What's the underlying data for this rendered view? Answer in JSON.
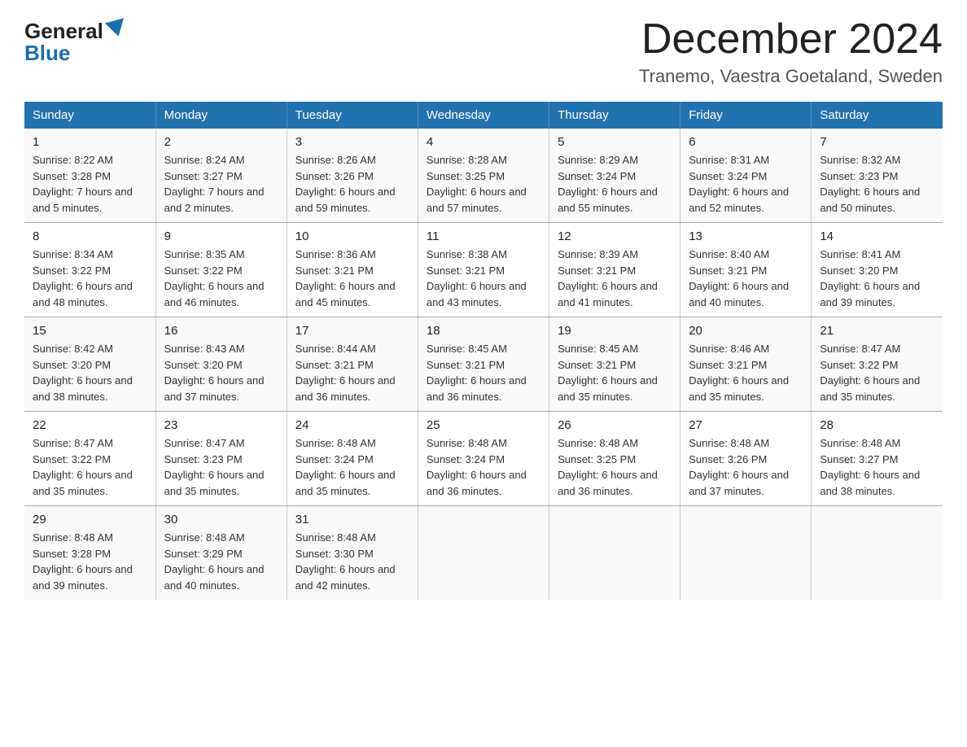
{
  "header": {
    "logo_general": "General",
    "logo_blue": "Blue",
    "main_title": "December 2024",
    "subtitle": "Tranemo, Vaestra Goetaland, Sweden"
  },
  "days_of_week": [
    "Sunday",
    "Monday",
    "Tuesday",
    "Wednesday",
    "Thursday",
    "Friday",
    "Saturday"
  ],
  "weeks": [
    [
      {
        "day": "1",
        "sunrise": "8:22 AM",
        "sunset": "3:28 PM",
        "daylight": "7 hours and 5 minutes."
      },
      {
        "day": "2",
        "sunrise": "8:24 AM",
        "sunset": "3:27 PM",
        "daylight": "7 hours and 2 minutes."
      },
      {
        "day": "3",
        "sunrise": "8:26 AM",
        "sunset": "3:26 PM",
        "daylight": "6 hours and 59 minutes."
      },
      {
        "day": "4",
        "sunrise": "8:28 AM",
        "sunset": "3:25 PM",
        "daylight": "6 hours and 57 minutes."
      },
      {
        "day": "5",
        "sunrise": "8:29 AM",
        "sunset": "3:24 PM",
        "daylight": "6 hours and 55 minutes."
      },
      {
        "day": "6",
        "sunrise": "8:31 AM",
        "sunset": "3:24 PM",
        "daylight": "6 hours and 52 minutes."
      },
      {
        "day": "7",
        "sunrise": "8:32 AM",
        "sunset": "3:23 PM",
        "daylight": "6 hours and 50 minutes."
      }
    ],
    [
      {
        "day": "8",
        "sunrise": "8:34 AM",
        "sunset": "3:22 PM",
        "daylight": "6 hours and 48 minutes."
      },
      {
        "day": "9",
        "sunrise": "8:35 AM",
        "sunset": "3:22 PM",
        "daylight": "6 hours and 46 minutes."
      },
      {
        "day": "10",
        "sunrise": "8:36 AM",
        "sunset": "3:21 PM",
        "daylight": "6 hours and 45 minutes."
      },
      {
        "day": "11",
        "sunrise": "8:38 AM",
        "sunset": "3:21 PM",
        "daylight": "6 hours and 43 minutes."
      },
      {
        "day": "12",
        "sunrise": "8:39 AM",
        "sunset": "3:21 PM",
        "daylight": "6 hours and 41 minutes."
      },
      {
        "day": "13",
        "sunrise": "8:40 AM",
        "sunset": "3:21 PM",
        "daylight": "6 hours and 40 minutes."
      },
      {
        "day": "14",
        "sunrise": "8:41 AM",
        "sunset": "3:20 PM",
        "daylight": "6 hours and 39 minutes."
      }
    ],
    [
      {
        "day": "15",
        "sunrise": "8:42 AM",
        "sunset": "3:20 PM",
        "daylight": "6 hours and 38 minutes."
      },
      {
        "day": "16",
        "sunrise": "8:43 AM",
        "sunset": "3:20 PM",
        "daylight": "6 hours and 37 minutes."
      },
      {
        "day": "17",
        "sunrise": "8:44 AM",
        "sunset": "3:21 PM",
        "daylight": "6 hours and 36 minutes."
      },
      {
        "day": "18",
        "sunrise": "8:45 AM",
        "sunset": "3:21 PM",
        "daylight": "6 hours and 36 minutes."
      },
      {
        "day": "19",
        "sunrise": "8:45 AM",
        "sunset": "3:21 PM",
        "daylight": "6 hours and 35 minutes."
      },
      {
        "day": "20",
        "sunrise": "8:46 AM",
        "sunset": "3:21 PM",
        "daylight": "6 hours and 35 minutes."
      },
      {
        "day": "21",
        "sunrise": "8:47 AM",
        "sunset": "3:22 PM",
        "daylight": "6 hours and 35 minutes."
      }
    ],
    [
      {
        "day": "22",
        "sunrise": "8:47 AM",
        "sunset": "3:22 PM",
        "daylight": "6 hours and 35 minutes."
      },
      {
        "day": "23",
        "sunrise": "8:47 AM",
        "sunset": "3:23 PM",
        "daylight": "6 hours and 35 minutes."
      },
      {
        "day": "24",
        "sunrise": "8:48 AM",
        "sunset": "3:24 PM",
        "daylight": "6 hours and 35 minutes."
      },
      {
        "day": "25",
        "sunrise": "8:48 AM",
        "sunset": "3:24 PM",
        "daylight": "6 hours and 36 minutes."
      },
      {
        "day": "26",
        "sunrise": "8:48 AM",
        "sunset": "3:25 PM",
        "daylight": "6 hours and 36 minutes."
      },
      {
        "day": "27",
        "sunrise": "8:48 AM",
        "sunset": "3:26 PM",
        "daylight": "6 hours and 37 minutes."
      },
      {
        "day": "28",
        "sunrise": "8:48 AM",
        "sunset": "3:27 PM",
        "daylight": "6 hours and 38 minutes."
      }
    ],
    [
      {
        "day": "29",
        "sunrise": "8:48 AM",
        "sunset": "3:28 PM",
        "daylight": "6 hours and 39 minutes."
      },
      {
        "day": "30",
        "sunrise": "8:48 AM",
        "sunset": "3:29 PM",
        "daylight": "6 hours and 40 minutes."
      },
      {
        "day": "31",
        "sunrise": "8:48 AM",
        "sunset": "3:30 PM",
        "daylight": "6 hours and 42 minutes."
      },
      null,
      null,
      null,
      null
    ]
  ],
  "labels": {
    "sunrise": "Sunrise:",
    "sunset": "Sunset:",
    "daylight": "Daylight:"
  }
}
